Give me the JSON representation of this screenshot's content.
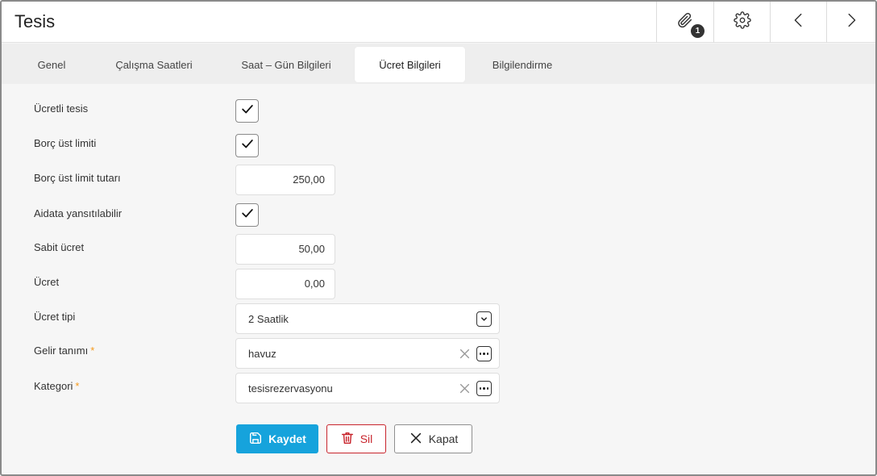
{
  "window": {
    "title": "Tesis"
  },
  "header": {
    "attachment_count": "1"
  },
  "tabs": [
    {
      "label": "Genel"
    },
    {
      "label": "Çalışma Saatleri"
    },
    {
      "label": "Saat – Gün Bilgileri"
    },
    {
      "label": "Ücret Bilgileri"
    },
    {
      "label": "Bilgilendirme"
    }
  ],
  "active_tab": "Ücret Bilgileri",
  "form": {
    "ucretli_tesis": {
      "label": "Ücretli tesis",
      "checked": true
    },
    "borc_ust_limiti": {
      "label": "Borç üst limiti",
      "checked": true
    },
    "borc_ust_limit_tutari": {
      "label": "Borç üst limit tutarı",
      "value": "250,00"
    },
    "aidata_yansitilabilir": {
      "label": "Aidata yansıtılabilir",
      "checked": true
    },
    "sabit_ucret": {
      "label": "Sabit ücret",
      "value": "50,00"
    },
    "ucret": {
      "label": "Ücret",
      "value": "0,00"
    },
    "ucret_tipi": {
      "label": "Ücret tipi",
      "value": "2 Saatlik"
    },
    "gelir_tanimi": {
      "label": "Gelir tanımı",
      "required": "*",
      "value": "havuz"
    },
    "kategori": {
      "label": "Kategori",
      "required": "*",
      "value": "tesisrezervasyonu"
    }
  },
  "buttons": {
    "save": "Kaydet",
    "delete": "Sil",
    "close": "Kapat"
  },
  "colors": {
    "primary": "#16a3dc",
    "danger": "#c8242c",
    "required": "#f59a1c"
  },
  "icons": {
    "attachment": "paperclip-icon",
    "settings": "gear-icon",
    "prev": "chevron-left-icon",
    "next": "chevron-right-icon",
    "check": "check-icon",
    "dropdown": "chevron-down-icon",
    "clear": "close-icon",
    "more": "ellipsis-icon",
    "save": "floppy-disk-icon",
    "delete": "trash-icon",
    "close": "close-icon"
  }
}
